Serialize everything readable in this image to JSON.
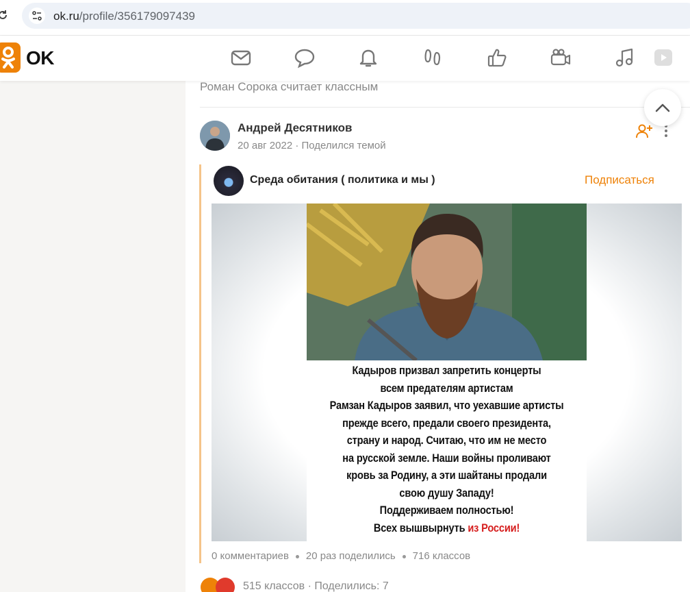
{
  "browser": {
    "url_host": "ok.ru",
    "url_path": "/profile/356179097439"
  },
  "header": {
    "logo_text": "OK",
    "icons": [
      "mail-icon",
      "chat-icon",
      "bell-icon",
      "guests-icon",
      "like-icon",
      "video-icon",
      "music-icon",
      "play-icon"
    ],
    "accent_color": "#ee8208"
  },
  "feed": {
    "previous_item_text": "Роман Сорока считает классным",
    "post": {
      "author_name": "Андрей Десятников",
      "date": "20 авг 2022",
      "action": "Поделился темой",
      "group": {
        "name": "Среда обитания ( политика и мы )",
        "subscribe_label": "Подписаться"
      },
      "image_text": {
        "line1": "Кадыров призвал запретить концерты",
        "line2": "всем предателям артистам",
        "line3": "Рамзан Кадыров заявил, что уехавшие артисты",
        "line4": "прежде всего, предали своего президента,",
        "line5": "страну и народ. Считаю, что им не место",
        "line6": "на русской земле. Наши войны проливают",
        "line7": "кровь за Родину, а эти шайтаны продали",
        "line8": "свою душу Западу!",
        "line9": "Поддерживаем полностью!",
        "line10_black": "Всех вышвырнуть",
        "line10_red": "из России!"
      },
      "inner_stats": {
        "comments": "0 комментариев",
        "shares": "20 раз поделились",
        "likes": "716 классов"
      },
      "outer_stats": {
        "likes": "515 классов",
        "shares": "Поделились: 7"
      }
    }
  }
}
